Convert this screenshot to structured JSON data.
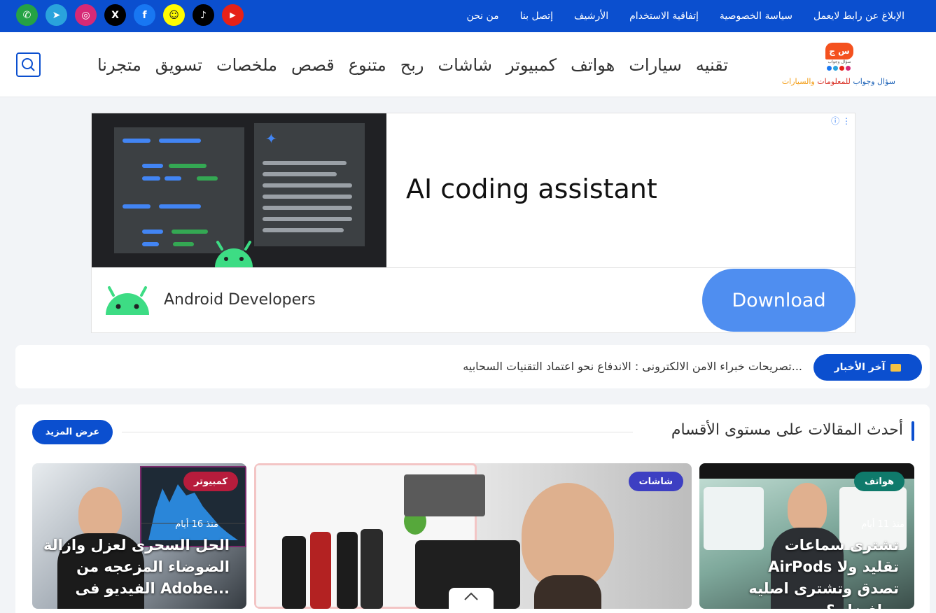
{
  "top_links": [
    "الإبلاغ عن رابط لايعمل",
    "سياسة الخصوصية",
    "إتفاقية الاستخدام",
    "الأرشيف",
    "إتصل بنا",
    "من نحن"
  ],
  "socials": [
    {
      "name": "whatsapp-icon",
      "glyph": "✆",
      "color": "#25a244"
    },
    {
      "name": "telegram-icon",
      "glyph": "➤",
      "color": "#2aa3dc"
    },
    {
      "name": "instagram-icon",
      "glyph": "◎",
      "color": "#d62976"
    },
    {
      "name": "x-icon",
      "glyph": "X",
      "color": "#000000"
    },
    {
      "name": "facebook-icon",
      "glyph": "f",
      "color": "#1877f2"
    },
    {
      "name": "snapchat-icon",
      "glyph": "☺",
      "color": "#fffc00"
    },
    {
      "name": "tiktok-icon",
      "glyph": "♪",
      "color": "#000000"
    },
    {
      "name": "youtube-icon",
      "glyph": "▶",
      "color": "#e62117"
    }
  ],
  "logo": {
    "badge": "س ج",
    "small": "سؤال وجواب",
    "text1": "سؤال وجواب ",
    "text2": "للمعلومات ",
    "text3": "والسيارات"
  },
  "nav": [
    "تقنيه",
    "سيارات",
    "هواتف",
    "كمبيوتر",
    "شاشات",
    "ربح",
    "متنوع",
    "قصص",
    "ملخصات",
    "تسويق",
    "متجرنا"
  ],
  "ad": {
    "headline": "AI coding assistant",
    "brand": "Android Developers",
    "cta": "Download",
    "info": "ⓘ ⋮"
  },
  "ticker": {
    "badge": "آخر الأخبار",
    "text": "تصريحات خبراء الامن الالكترونى : الاندفاع نحو اعتماد التقنيات السحابيه..."
  },
  "section": {
    "title": "أحدث المقالات على مستوى الأقسام",
    "more": "عرض المزيد",
    "cards": [
      {
        "category": "هواتف",
        "cat_color": "#0f7a6b",
        "date": "منذ 11 أيام",
        "title": "تشترى سماعات AirPods تقليد ولا تصدق وتشترى اصليه افضل ؟..."
      },
      {
        "category": "شاشات",
        "cat_color": "#3d3fc2",
        "date": "",
        "title": ""
      },
      {
        "category": "كمبيوتر",
        "cat_color": "#b71c3c",
        "date": "منذ 16 أيام",
        "title": "الحل السحرى لعزل وازالة الضوضاء المزعجه من الفيديو فى Adobe..."
      }
    ]
  },
  "colors": {
    "primary": "#0b4fcf",
    "ad_cta": "#4f8ef0"
  }
}
